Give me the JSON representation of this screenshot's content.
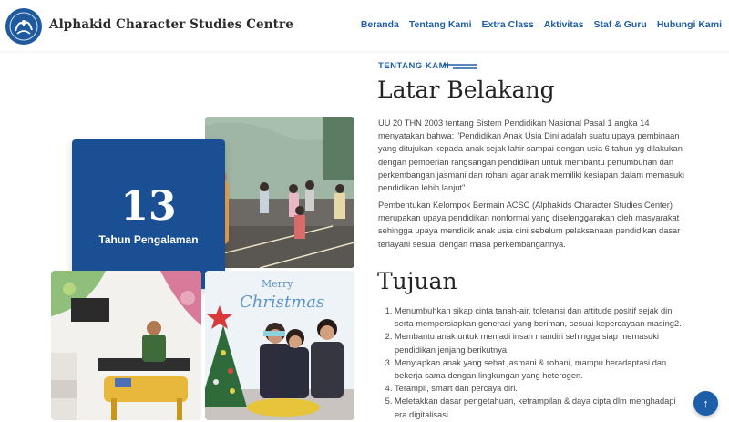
{
  "header": {
    "brand": "Alphakid Character Studies Centre",
    "nav": [
      "Beranda",
      "Tentang Kami",
      "Extra Class",
      "Aktivitas",
      "Staf & Guru",
      "Hubungi Kami"
    ]
  },
  "experience": {
    "number": "13",
    "label": "Tahun Pengalaman"
  },
  "photos": {
    "christmas_sign": "Merry Christmas"
  },
  "about": {
    "tag": "TENTANG KAMI",
    "heading": "Latar Belakang",
    "paragraph1": "UU 20 THN 2003 tentang Sistem Pendidikan Nasional Pasal 1 angka 14 menyatakan bahwa: \"Pendidikan Anak Usia Dini adalah suatu upaya pembinaan yang ditujukan kepada anak sejak lahir sampai dengan usia 6 tahun yg dilakukan dengan pemberian rangsangan pendidikan untuk membantu pertumbuhan dan perkembangan jasmani dan rohani agar anak memiliki kesiapan dalam memasuki pendidikan lebih lanjut\"",
    "paragraph2": "Pembentukan Kelompok Bermain ACSC (Alphakids Character Studies Center) merupakan upaya pendidikan nonformal yang diselenggarakan oleh masyarakat sehingga upaya mendidik anak usia dini sebelum pelaksanaan pendidikan dasar terlayani sesuai dengan masa perkembangannya."
  },
  "goals": {
    "heading": "Tujuan",
    "items": [
      "Menumbuhkan sikap cinta tanah-air, toleransi dan attitude positif sejak dini serta mempersiapkan generasi yang beriman, sesuai kepercayaan masing2.",
      "Membantu anak untuk menjadi insan mandiri sehingga siap memasuki pendidikan jenjang berikutnya.",
      "Menyiapkan anak yang sehat jasmani & rohani, mampu beradaptasi dan bekerja sama dengan lingkungan yang heterogen.",
      "Terampil, smart dan percaya diri.",
      "Meletakkan dasar pengetahuan, ketrampilan & daya cipta dlm menghadapi era digitalisasi."
    ]
  },
  "back_to_top_icon": "arrow-up-icon",
  "colors": {
    "primary": "#1d5ea9",
    "experience_box": "#1b4f93"
  }
}
